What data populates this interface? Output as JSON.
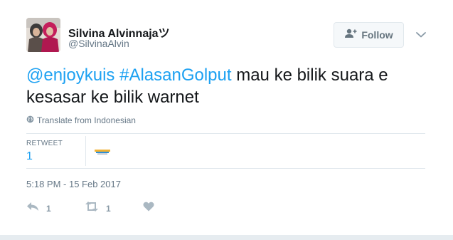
{
  "author": {
    "name": "Silvina Alvinnajaツ",
    "handle": "@SilvinaAlvin"
  },
  "follow_button": {
    "label": "Follow"
  },
  "tweet": {
    "mention": "@enjoykuis",
    "hashtag": "#AlasanGolput",
    "text_rest": " mau ke bilik suara e kesasar ke bilik warnet"
  },
  "translate_label": "Translate from Indonesian",
  "stats": {
    "retweet_label": "RETWEET",
    "retweet_count": "1"
  },
  "timestamp": "5:18 PM - 15 Feb 2017",
  "actions": {
    "reply_count": "1",
    "retweet_count": "1"
  },
  "colors": {
    "link": "#1da1f2",
    "secondary_text": "#657786",
    "action_icon": "#aab8c2"
  },
  "icons": {
    "follow": "add-person-icon",
    "caret": "chevron-down-icon",
    "translate": "globe-icon",
    "reply": "reply-icon",
    "retweet": "retweet-icon",
    "like": "heart-icon"
  }
}
